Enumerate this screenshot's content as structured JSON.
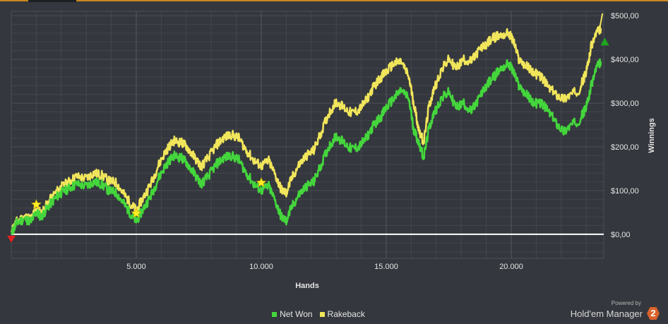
{
  "colors": {
    "net_won": "#44d63c",
    "rakeback": "#f1e55b",
    "zero_line": "#ffffff",
    "star": "#ffee22",
    "start_marker": "#e02020",
    "end_marker": "#1fa51f"
  },
  "chart_data": {
    "type": "line",
    "xlabel": "Hands",
    "ylabel": "Winnings",
    "xlim": [
      0,
      23700
    ],
    "ylim": [
      -55,
      510
    ],
    "x_ticks": [
      5000,
      10000,
      15000,
      20000
    ],
    "x_tick_labels": [
      "5.000",
      "10.000",
      "15.000",
      "20.000"
    ],
    "y_ticks": [
      0,
      100,
      200,
      300,
      400,
      500
    ],
    "y_tick_labels": [
      "$0,00",
      "$100,00",
      "$200,00",
      "$300,00",
      "$400,00",
      "$500,00"
    ],
    "grid": true,
    "legend_position": "bottom",
    "markers": {
      "stars_at_hands": [
        1000,
        5000,
        10000
      ],
      "start": [
        0,
        -10
      ],
      "end": [
        23600,
        440
      ]
    },
    "series": [
      {
        "name": "Net Won",
        "x": [
          0,
          200,
          500,
          800,
          1000,
          1200,
          1500,
          1800,
          2000,
          2300,
          2600,
          3000,
          3300,
          3600,
          3900,
          4200,
          4500,
          4800,
          5000,
          5300,
          5600,
          5900,
          6200,
          6500,
          6800,
          7000,
          7300,
          7600,
          7900,
          8200,
          8500,
          8800,
          9100,
          9400,
          9700,
          10000,
          10300,
          10600,
          10800,
          11000,
          11200,
          11500,
          11800,
          12100,
          12400,
          12700,
          13000,
          13300,
          13600,
          13900,
          14200,
          14500,
          14800,
          15000,
          15300,
          15600,
          15900,
          16100,
          16300,
          16500,
          16700,
          16900,
          17200,
          17500,
          17800,
          18100,
          18400,
          18700,
          19000,
          19300,
          19600,
          19900,
          20100,
          20300,
          20600,
          20900,
          21200,
          21500,
          21800,
          22100,
          22400,
          22700,
          23000,
          23200,
          23400,
          23600
        ],
        "y": [
          0,
          25,
          35,
          30,
          50,
          40,
          65,
          85,
          95,
          105,
          115,
          110,
          120,
          115,
          100,
          95,
          70,
          45,
          30,
          60,
          90,
          130,
          160,
          180,
          175,
          165,
          140,
          115,
          135,
          160,
          175,
          180,
          170,
          140,
          115,
          100,
          110,
          70,
          40,
          30,
          60,
          90,
          110,
          120,
          160,
          200,
          225,
          210,
          195,
          200,
          220,
          250,
          270,
          290,
          310,
          330,
          310,
          240,
          210,
          175,
          240,
          275,
          310,
          325,
          290,
          300,
          280,
          310,
          340,
          360,
          380,
          390,
          370,
          340,
          320,
          300,
          300,
          280,
          255,
          235,
          250,
          260,
          290,
          340,
          380,
          395
        ]
      },
      {
        "name": "Rakeback",
        "x": [
          0,
          200,
          500,
          800,
          1000,
          1200,
          1500,
          1800,
          2000,
          2300,
          2600,
          3000,
          3300,
          3600,
          3900,
          4200,
          4500,
          4800,
          5000,
          5300,
          5600,
          5900,
          6200,
          6500,
          6800,
          7000,
          7300,
          7600,
          7900,
          8200,
          8500,
          8800,
          9100,
          9400,
          9700,
          10000,
          10300,
          10600,
          10800,
          11000,
          11200,
          11500,
          11800,
          12100,
          12400,
          12700,
          13000,
          13300,
          13600,
          13900,
          14200,
          14500,
          14800,
          15000,
          15300,
          15600,
          15900,
          16100,
          16300,
          16500,
          16700,
          16900,
          17200,
          17500,
          17800,
          18100,
          18400,
          18700,
          19000,
          19300,
          19600,
          19900,
          20100,
          20300,
          20600,
          20900,
          21200,
          21500,
          21800,
          22100,
          22400,
          22700,
          23000,
          23200,
          23400,
          23600
        ],
        "y": [
          5,
          28,
          40,
          36,
          58,
          48,
          75,
          97,
          108,
          120,
          132,
          128,
          140,
          136,
          122,
          118,
          92,
          68,
          54,
          86,
          118,
          160,
          192,
          214,
          210,
          202,
          178,
          155,
          177,
          204,
          221,
          228,
          220,
          192,
          169,
          156,
          168,
          130,
          102,
          94,
          126,
          158,
          180,
          192,
          234,
          276,
          303,
          290,
          277,
          284,
          306,
          338,
          360,
          372,
          390,
          395,
          360,
          300,
          240,
          210,
          290,
          330,
          375,
          400,
          380,
          400,
          395,
          420,
          435,
          450,
          455,
          460,
          440,
          400,
          385,
          370,
          360,
          335,
          320,
          310,
          320,
          330,
          370,
          430,
          460,
          470
        ]
      }
    ]
  },
  "legend": {
    "items": [
      {
        "label": "Net Won"
      },
      {
        "label": "Rakeback"
      }
    ]
  },
  "branding": {
    "powered_by": "Powered by",
    "product": "Hold'em Manager",
    "logo_text": "2"
  }
}
